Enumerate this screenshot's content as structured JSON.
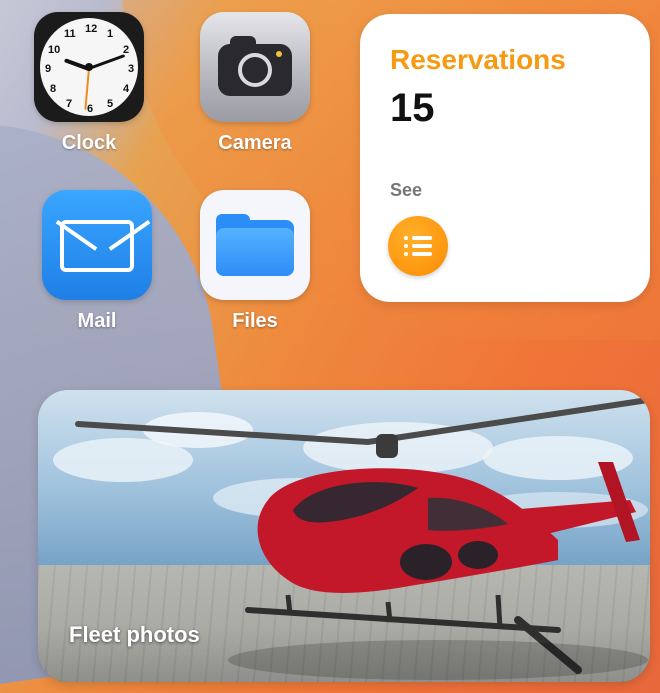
{
  "apps": [
    {
      "label": "Clock",
      "icon": "clock-icon"
    },
    {
      "label": "Camera",
      "icon": "camera-icon"
    },
    {
      "label": "Mail",
      "icon": "mail-icon"
    },
    {
      "label": "Files",
      "icon": "files-icon"
    }
  ],
  "reservations_widget": {
    "title": "Reservations",
    "count": "15",
    "see_label": "See",
    "button_icon": "list-icon",
    "accent": "#f59a12"
  },
  "photo_widget": {
    "caption": "Fleet photos",
    "image": "helicopter-on-helipad"
  }
}
